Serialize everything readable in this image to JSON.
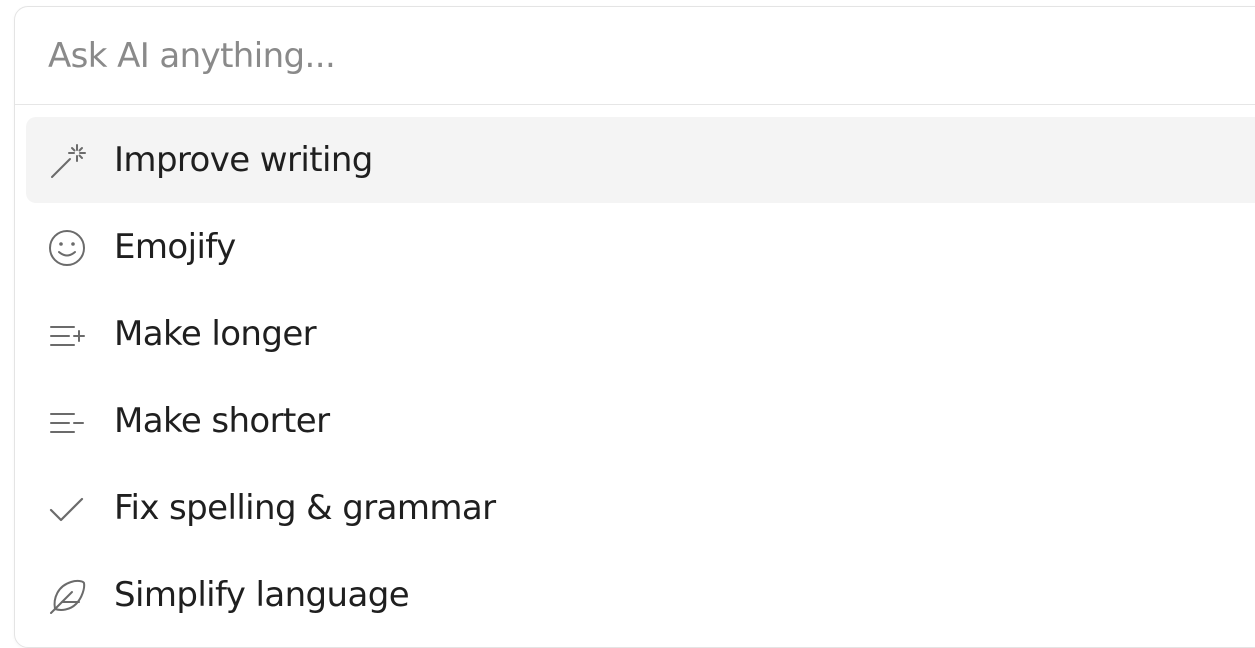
{
  "ask": {
    "placeholder": "Ask AI anything..."
  },
  "menu": {
    "items": [
      {
        "label": "Improve writing",
        "icon": "magic-wand-icon",
        "active": true
      },
      {
        "label": "Emojify",
        "icon": "smiley-icon",
        "active": false
      },
      {
        "label": "Make longer",
        "icon": "lines-plus-icon",
        "active": false
      },
      {
        "label": "Make shorter",
        "icon": "lines-minus-icon",
        "active": false
      },
      {
        "label": "Fix spelling & grammar",
        "icon": "checkmark-icon",
        "active": false
      },
      {
        "label": "Simplify language",
        "icon": "feather-icon",
        "active": false
      }
    ]
  },
  "colors": {
    "text": "#1f1f1f",
    "placeholder": "#8a8a8a",
    "icon": "#6b6b6b",
    "active_bg": "#f4f4f4",
    "border": "#e4e4e4"
  }
}
